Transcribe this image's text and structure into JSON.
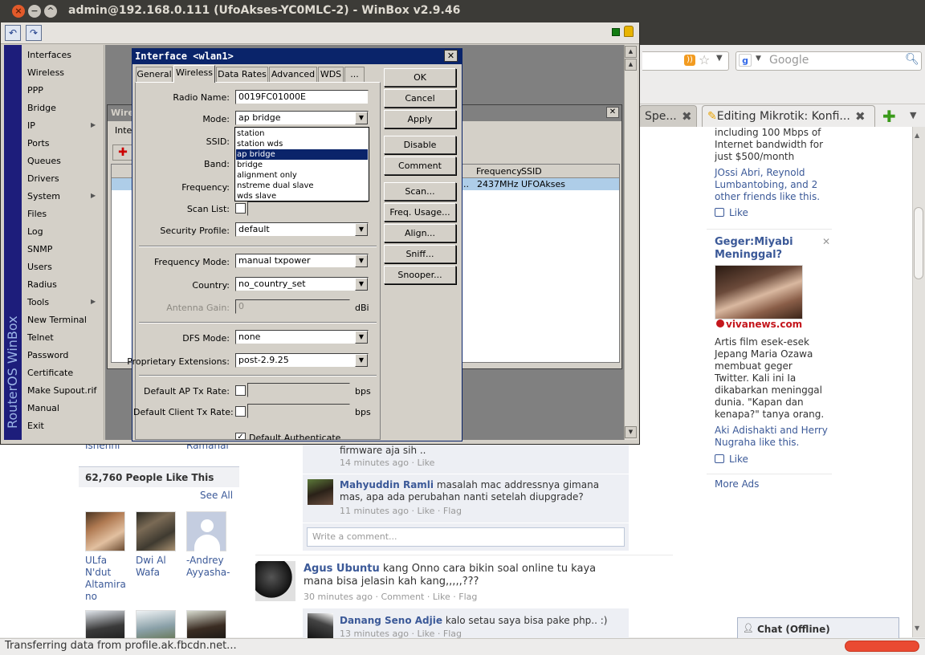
{
  "winbox": {
    "title": "admin@192.168.0.111 (UfoAkses-YC0MLC-2) - WinBox v2.9.46",
    "brand": "RouterOS WinBox",
    "menu": [
      "Interfaces",
      "Wireless",
      "PPP",
      "Bridge",
      "IP",
      "Ports",
      "Queues",
      "Drivers",
      "System",
      "Files",
      "Log",
      "SNMP",
      "Users",
      "Radius",
      "Tools",
      "New Terminal",
      "Telnet",
      "Password",
      "Certificate",
      "Make Supout.rif",
      "Manual",
      "Exit"
    ],
    "menu_submenu_items": [
      "IP",
      "System",
      "Tools"
    ],
    "back_window": {
      "title": "Wire",
      "tab_label": "Inte",
      "columns": [
        "Frequency",
        "SSID"
      ],
      "row": {
        "name": "..",
        "frequency": "2437MHz",
        "ssid": "UFOAkses"
      }
    }
  },
  "dialog": {
    "title": "Interface <wlan1>",
    "tabs": [
      "General",
      "Wireless",
      "Data Rates",
      "Advanced",
      "WDS",
      "..."
    ],
    "active_tab": "Wireless",
    "fields": {
      "radio_name": {
        "label": "Radio Name:",
        "value": "0019FC01000E"
      },
      "mode": {
        "label": "Mode:",
        "value": "ap bridge"
      },
      "ssid": {
        "label": "SSID:"
      },
      "band": {
        "label": "Band:"
      },
      "frequency": {
        "label": "Frequency:"
      },
      "scan_list": {
        "label": "Scan List:"
      },
      "security_profile": {
        "label": "Security Profile:",
        "value": "default"
      },
      "frequency_mode": {
        "label": "Frequency Mode:",
        "value": "manual txpower"
      },
      "country": {
        "label": "Country:",
        "value": "no_country_set"
      },
      "antenna_gain": {
        "label": "Antenna Gain:",
        "value": "0",
        "unit": "dBi"
      },
      "dfs_mode": {
        "label": "DFS Mode:",
        "value": "none"
      },
      "proprietary_extensions": {
        "label": "Proprietary Extensions:",
        "value": "post-2.9.25"
      },
      "default_ap_tx_rate": {
        "label": "Default AP Tx Rate:",
        "unit": "bps"
      },
      "default_client_tx_rate": {
        "label": "Default Client Tx Rate:",
        "unit": "bps"
      },
      "default_authenticate": {
        "label": "Default Authenticate",
        "checked": true
      }
    },
    "mode_options": [
      "station",
      "station wds",
      "ap bridge",
      "bridge",
      "alignment only",
      "nstreme dual slave",
      "wds slave"
    ],
    "mode_selected": "ap bridge",
    "buttons": [
      "OK",
      "Cancel",
      "Apply",
      "Disable",
      "Comment",
      "Scan...",
      "Freq. Usage...",
      "Align...",
      "Sniff...",
      "Snooper..."
    ]
  },
  "browser": {
    "search_placeholder": "Google",
    "tabs": [
      {
        "label": "Spe...",
        "close": "✖"
      },
      {
        "label": "Editing Mikrotik: Konfi...",
        "close": "✖"
      }
    ],
    "status": "Transferring data from profile.ak.fbcdn.net..."
  },
  "facebook": {
    "ad1": {
      "text": "including 100 Mbps of Internet bandwidth for just $500/month",
      "friends": "JOssi Abri, Reynold Lumbantobing, and 2 other friends like this.",
      "like": "Like"
    },
    "ad2": {
      "title": "Geger:Miyabi Meninggal?",
      "source": "vivanews.com",
      "text": "Artis film esek-esek Jepang Maria Ozawa membuat geger Twitter. Kali ini Ia dikabarkan meninggal dunia. \"Kapan dan kenapa?\" tanya orang.",
      "friends": "Aki Adishakti and Herry Nugraha like this.",
      "like": "Like"
    },
    "more_ads": "More Ads",
    "sidebar": {
      "cut_names": [
        "Ishehhi",
        "Ramahal"
      ],
      "likes_title": "62,760 People Like This",
      "see_all": "See All",
      "people": [
        "ULfa N'dut Altamira no",
        "Dwi Al Wafa",
        "-Andrey Ayyasha-"
      ]
    },
    "comments": [
      {
        "text": "firmware aja sih ..",
        "meta": "14 minutes ago · Like"
      },
      {
        "author": "Mahyuddin Ramli",
        "text": "masalah mac addressnya gimana mas, apa ada perubahan nanti setelah diupgrade?",
        "meta": "11 minutes ago · Like · Flag"
      }
    ],
    "write_comment_placeholder": "Write a comment...",
    "post": {
      "author": "Agus Ubuntu",
      "text": "kang Onno cara bikin soal online tu kaya mana bisa jelasin kah kang,,,,,???",
      "meta": "30 minutes ago · Comment · Like · Flag"
    },
    "reply": {
      "author": "Danang Seno Adjie",
      "text": "kalo setau saya bisa pake php.. :)",
      "meta": "13 minutes ago · Like · Flag"
    },
    "chat": "Chat (Offline)"
  },
  "colors": {
    "winbox_title": "#0a246a",
    "brand_strip": "#1d1d7b",
    "fb_link": "#3b5998",
    "progress": "#ea4a32"
  }
}
